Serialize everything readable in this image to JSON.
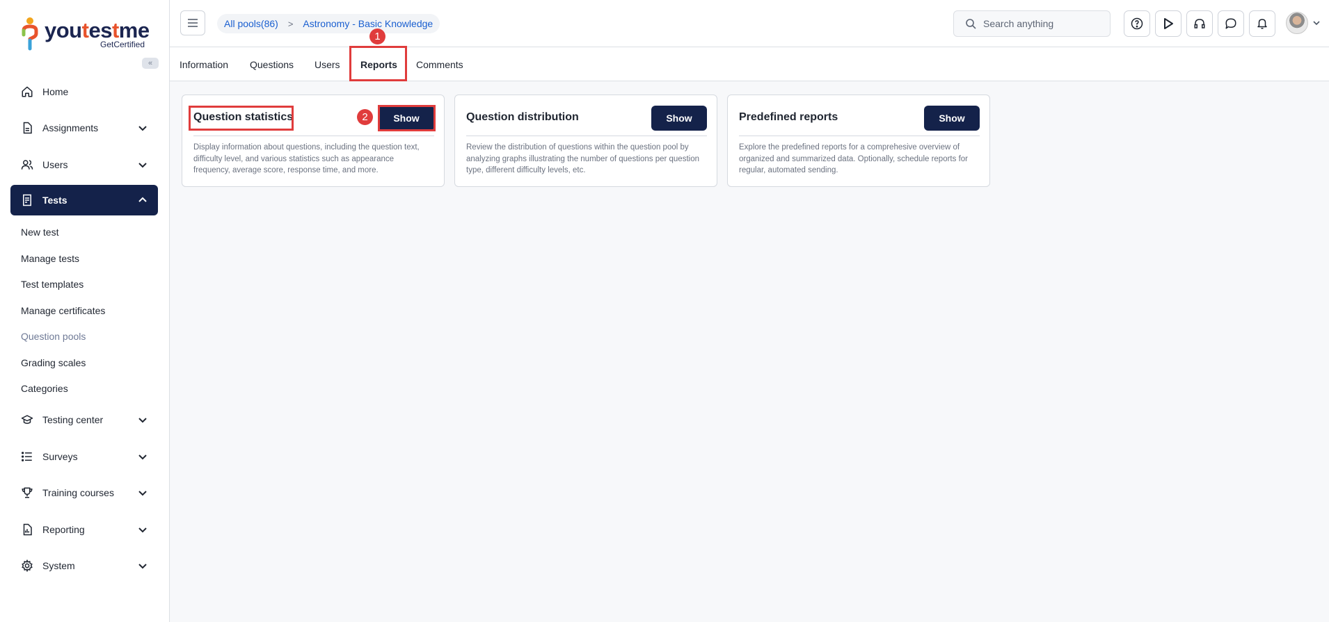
{
  "brand": {
    "logo_you": "you",
    "logo_t": "t",
    "logo_es": "es",
    "logo_t2": "t",
    "logo_me": "me",
    "logo_sub": "GetCertified",
    "collapse_glyph": "«"
  },
  "sidebar": {
    "items": [
      {
        "label": "Home",
        "icon": "home-icon"
      },
      {
        "label": "Assignments",
        "icon": "assignments-icon"
      },
      {
        "label": "Users",
        "icon": "users-icon"
      },
      {
        "label": "Tests",
        "icon": "tests-icon"
      },
      {
        "label": "Testing center",
        "icon": "testing-center-icon"
      },
      {
        "label": "Surveys",
        "icon": "surveys-icon"
      },
      {
        "label": "Training courses",
        "icon": "trophy-icon"
      },
      {
        "label": "Reporting",
        "icon": "reporting-icon"
      },
      {
        "label": "System",
        "icon": "gear-icon"
      }
    ],
    "tests_submenu": [
      "New test",
      "Manage tests",
      "Test templates",
      "Manage certificates",
      "Question pools",
      "Grading scales",
      "Categories"
    ],
    "current_submenu": "Question pools"
  },
  "header": {
    "breadcrumb_pools": "All pools(86)",
    "breadcrumb_sep": ">",
    "breadcrumb_current": "Astronomy - Basic Knowledge",
    "search_placeholder": "Search anything",
    "icons": [
      "help-icon",
      "play-icon",
      "headset-icon",
      "chat-icon",
      "bell-icon"
    ]
  },
  "tabs": {
    "items": [
      "Information",
      "Questions",
      "Users",
      "Reports",
      "Comments"
    ],
    "active": "Reports"
  },
  "annotations": {
    "step1": "1",
    "step2": "2",
    "color": "#e03c3c"
  },
  "cards": [
    {
      "title": "Question statistics",
      "button": "Show",
      "description": "Display information about questions, including the question text, difficulty level, and various statistics such as appearance frequency, average score, response time, and more."
    },
    {
      "title": "Question distribution",
      "button": "Show",
      "description": "Review the distribution of questions within the question pool by analyzing graphs illustrating the number of questions per question type, different difficulty levels, etc."
    },
    {
      "title": "Predefined reports",
      "button": "Show",
      "description": "Explore the predefined reports for a comprehesive overview of organized and summarized data. Optionally, schedule reports for regular, automated sending."
    }
  ],
  "colors": {
    "accent": "#14224a",
    "link": "#1a5fd0",
    "highlight": "#e03c3c"
  }
}
